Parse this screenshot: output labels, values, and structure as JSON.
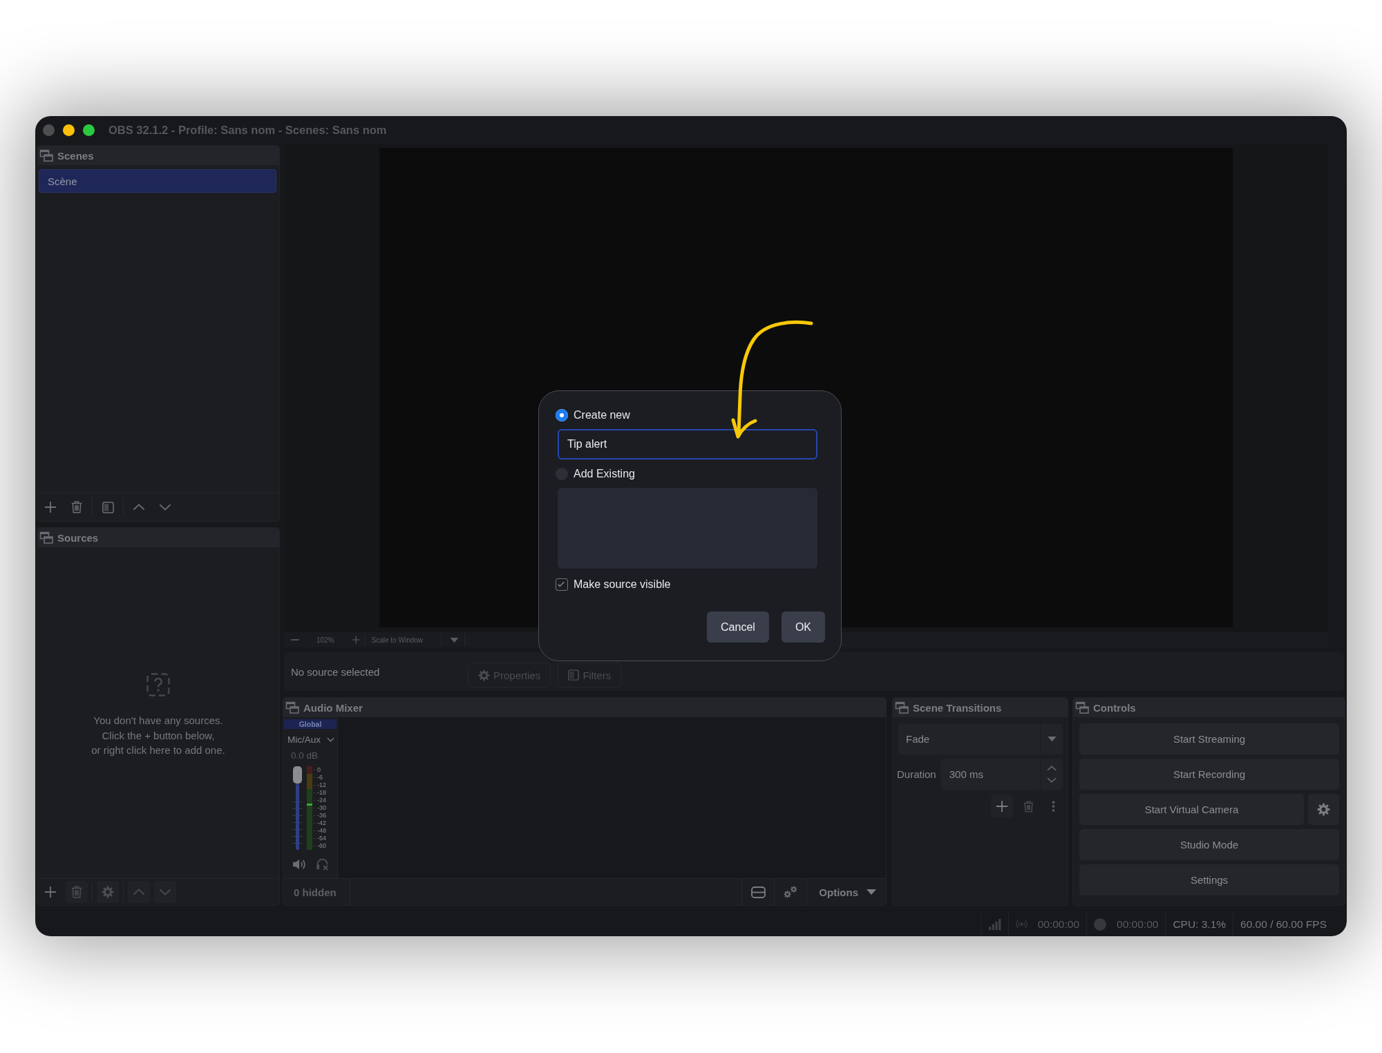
{
  "window": {
    "title": "OBS 32.1.2 - Profile: Sans nom - Scenes: Sans nom"
  },
  "scenes": {
    "title": "Scenes",
    "items": [
      {
        "label": "Scène",
        "selected": true
      }
    ]
  },
  "sources": {
    "title": "Sources",
    "empty_message": "You don't have any sources.\nClick the + button below,\nor right click here to add one."
  },
  "preview": {
    "zoom": "102%",
    "scale_mode": "Scale to Window"
  },
  "source_toolbar": {
    "status": "No source selected",
    "buttons": [
      {
        "kind": "properties",
        "label": "Properties",
        "disabled": true
      },
      {
        "kind": "filters",
        "label": "Filters",
        "disabled": true
      }
    ]
  },
  "audio_mixer": {
    "title": "Audio Mixer",
    "channels": [
      {
        "group": "Global",
        "name": "Mic/Aux",
        "reading": "0.0 dB",
        "level": 1,
        "scale": [
          "0",
          "-6",
          "-12",
          "-18",
          "-24",
          "-30",
          "-36",
          "-42",
          "-48",
          "-54",
          "-60"
        ]
      }
    ],
    "hidden_count": "0 hidden",
    "options": "Options"
  },
  "scene_transitions": {
    "title": "Scene Transitions",
    "transition": "Fade",
    "duration_label": "Duration",
    "duration": "300 ms"
  },
  "controls": {
    "title": "Controls",
    "buttons": [
      {
        "kind": "plain",
        "label": "Start Streaming"
      },
      {
        "kind": "plain",
        "label": "Start Recording"
      },
      {
        "kind": "with_settings",
        "label": "Start Virtual Camera"
      },
      {
        "kind": "plain",
        "label": "Studio Mode"
      },
      {
        "kind": "plain",
        "label": "Settings"
      }
    ]
  },
  "status_bar": {
    "stream_time": "00:00:00",
    "record_time": "00:00:00",
    "cpu": "CPU: 3.1%",
    "fps": "60.00 / 60.00 FPS"
  },
  "dialog": {
    "choices": [
      {
        "kind": "create_new",
        "label": "Create new",
        "selected": true,
        "value": "Tip alert"
      },
      {
        "kind": "add_existing",
        "label": "Add Existing",
        "selected": false
      }
    ],
    "make_visible": {
      "label": "Make source visible",
      "checked": true
    },
    "buttons": [
      "Cancel",
      "OK"
    ]
  }
}
